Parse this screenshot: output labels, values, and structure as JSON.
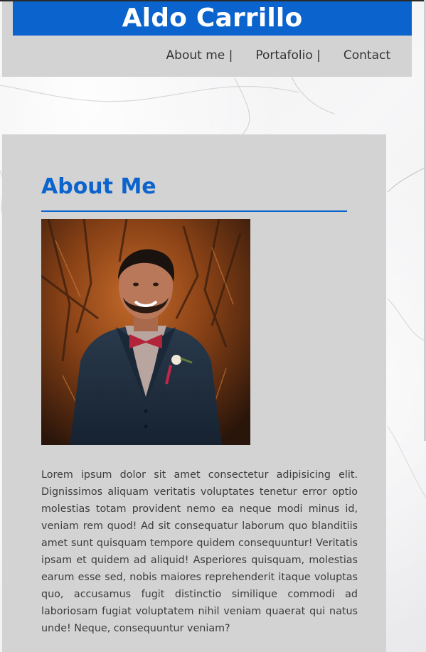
{
  "header": {
    "brand_name": "Aldo Carrillo",
    "nav": [
      {
        "label": "About me |"
      },
      {
        "label": "Portafolio |"
      },
      {
        "label": "Contact"
      }
    ]
  },
  "about": {
    "title": "About Me",
    "bio": "Lorem ipsum dolor sit amet consectetur adipisicing elit. Dignissimos aliquam veritatis voluptates tenetur error optio molestias totam provident nemo ea neque modi minus id, veniam rem quod! Ad sit consequatur laborum quo blanditiis amet sunt quisquam tempore quidem consequuntur! Veritatis ipsam et quidem ad aliquid! Asperiores quisquam, molestias earum esse sed, nobis maiores reprehenderit itaque voluptas quo, accusamus fugit distinctio similique commodi ad laboriosam fugiat voluptatem nihil veniam quaerat qui natus unde! Neque, consequuntur veniam?"
  },
  "colors": {
    "brand": "#0b63ce",
    "panel": "#d3d3d3",
    "text": "#3c3c3c"
  }
}
